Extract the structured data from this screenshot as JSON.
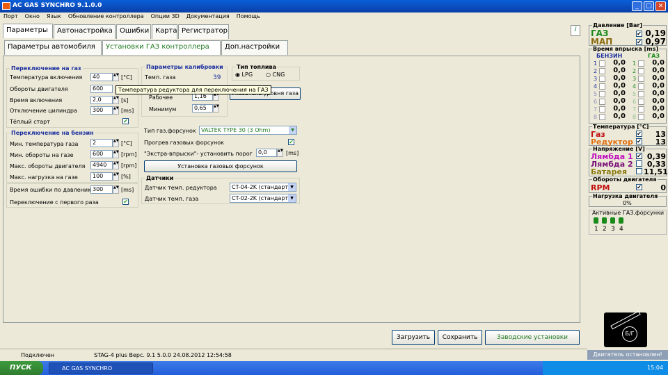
{
  "window": {
    "title": "AC GAS SYNCHRO  9.1.0.0"
  },
  "menu": [
    "Порт",
    "Окно",
    "Язык",
    "Обновление контроллера",
    "Опции 3D",
    "Документация",
    "Помощь"
  ],
  "main_tabs": [
    "Параметры",
    "Автонастройка",
    "Ошибки",
    "Карта",
    "Регистратор"
  ],
  "sub_tabs": [
    "Параметры автомобиля",
    "Установки ГАЗ контроллера",
    "Доп.настройки"
  ],
  "switch_to_gas": {
    "title": "Переключение на газ",
    "fields": [
      {
        "label": "Температура включения",
        "value": "40",
        "unit": "[°C]"
      },
      {
        "label": "Обороты двигателя",
        "value": "600",
        "unit": "[rpm]"
      },
      {
        "label": "Время включения",
        "value": "2,0",
        "unit": "[s]"
      },
      {
        "label": "Отключение цилиндра",
        "value": "300",
        "unit": "[ms]"
      }
    ],
    "warm_start": "Тёплый старт"
  },
  "switch_to_petrol": {
    "title": "Переключение на бензин",
    "fields": [
      {
        "label": "Мин. температура газа",
        "value": "2",
        "unit": "[°C]"
      },
      {
        "label": "Мин. обороты на газе",
        "value": "600",
        "unit": "[rpm]"
      },
      {
        "label": "Макс. обороты двигателя",
        "value": "4940",
        "unit": "[rpm]"
      },
      {
        "label": "Макс. нагрузка на газе",
        "value": "100",
        "unit": "[%]"
      }
    ]
  },
  "pressure_error": {
    "label": "Время ошибки по давлению",
    "value": "300",
    "unit": "[ms]"
  },
  "first_time_switch": "Переключение с первого раза",
  "calibration": {
    "title": "Параметры калибровки",
    "temp_gas_label": "Темп. газа",
    "temp_gas_value": "39",
    "working_label": "Рабочее",
    "working_value": "1,16",
    "minimum_label": "Минимум",
    "minimum_value": "0,65"
  },
  "tooltip": "Температура редуктора для переключения на ГАЗ",
  "fuel_type": {
    "title": "Тип топлива",
    "options": [
      "LPG",
      "CNG"
    ],
    "selected": "LPG"
  },
  "level_indicator_button": "Указатель уровня газа",
  "injectors": {
    "label": "Тип газ.форсунок",
    "value": "VALTEK TYPE 30 (3 Ohm)"
  },
  "injector_heating": "Прогрев газовых форсунок",
  "extra_injection": {
    "label": "\"Экстра-впрыски\"- установить порог",
    "value": "0,0",
    "unit": "[ms]"
  },
  "install_injectors_button": "Установка газовых форсунок",
  "sensors": {
    "title": "Датчики",
    "reducer_label": "Датчик темп. редуктора",
    "reducer_value": "CT-04-2K (стандарт",
    "gas_label": "Датчик темп. газа",
    "gas_value": "CT-02-2K (стандарт"
  },
  "buttons": {
    "load": "Загрузить",
    "save": "Сохранить",
    "factory": "Заводские установки"
  },
  "status": {
    "connection": "Подключен",
    "device": "STAG-4 plus  Верс. 9.1  5.0.0   24.08.2012 12:54:58"
  },
  "right_panel": {
    "pressure_title": "Давление [Bar]",
    "gas_label": "ГАЗ",
    "gas_value": "0,19",
    "map_label": "МАП",
    "map_value": "0,97",
    "injection_title": "Время впрыска [ms]",
    "petrol_col": "БЕНЗИН",
    "gas_col": "ГАЗ",
    "cylinders": [
      "1",
      "2",
      "3",
      "4",
      "5",
      "6",
      "7",
      "8"
    ],
    "petrol_values": [
      "0,0",
      "0,0",
      "0,0",
      "0,0",
      "0,0",
      "0,0",
      "0,0",
      "0,0"
    ],
    "gas_values": [
      "0,0",
      "0,0",
      "0,0",
      "0,0",
      "0,0",
      "0,0",
      "0,0",
      "0,0"
    ],
    "temp_title": "Температура [°C]",
    "temp_gas_label": "Газ",
    "temp_gas_value": "13",
    "reducer_label": "Редуктор",
    "reducer_value": "13",
    "voltage_title": "Напряжение [V]",
    "lambda1_label": "Лямбда 1",
    "lambda1_value": "0,39",
    "lambda2_label": "Лямбда 2",
    "lambda2_value": "0,33",
    "battery_label": "Батарея",
    "battery_value": "11,51",
    "rpm_title": "Обороты двигателя",
    "rpm_label": "RPM",
    "rpm_value": "0",
    "load_title": "Нагрузка двигателя",
    "load_value": "0%",
    "active_injectors_title": "Активные ГАЗ.форсунки",
    "active_injectors": [
      "1",
      "2",
      "3",
      "4"
    ],
    "switch_label": "Б/Г",
    "engine_status": "Двигатель остановлен!"
  },
  "taskbar": {
    "start": "ПУСК",
    "task": "AC GAS SYNCHRO",
    "clock": "15:04"
  }
}
